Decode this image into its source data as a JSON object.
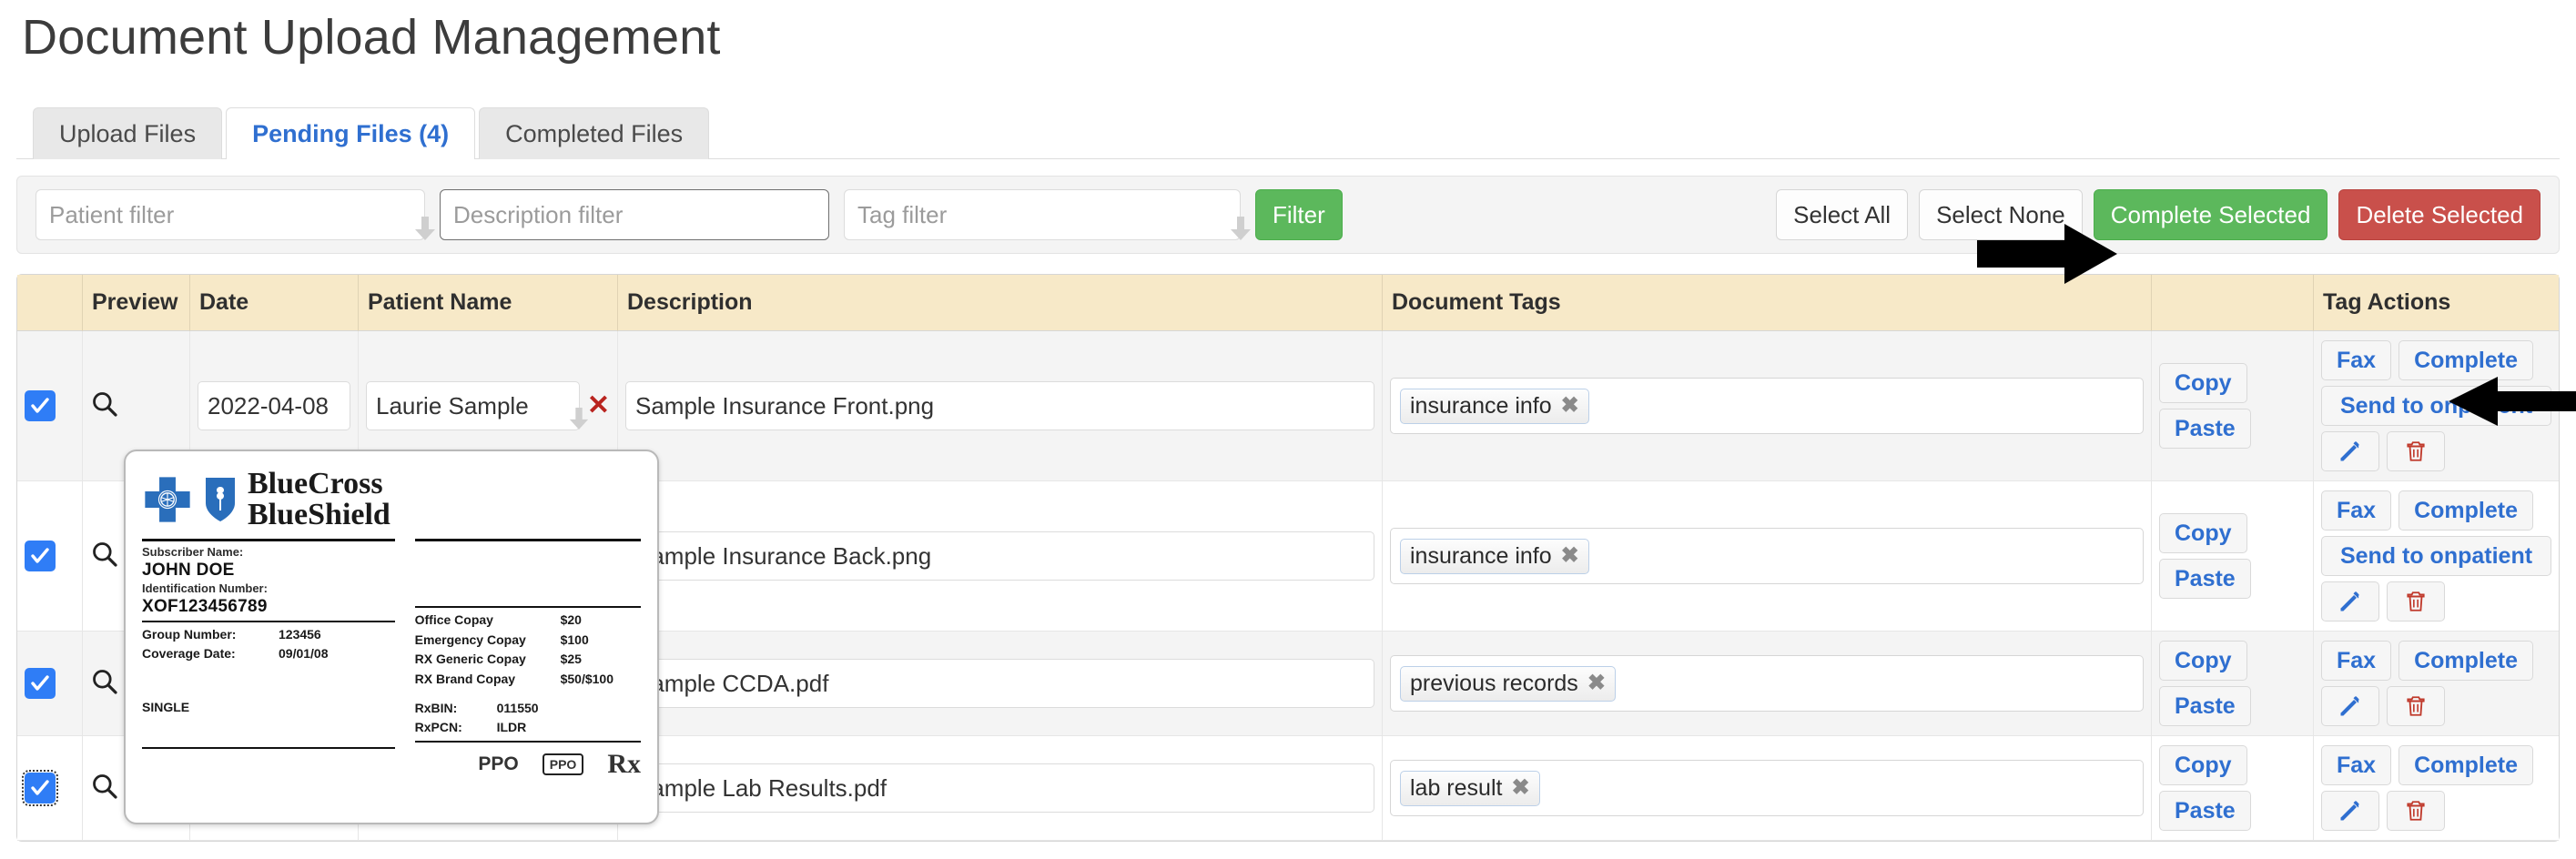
{
  "page": {
    "title": "Document Upload Management"
  },
  "tabs": [
    {
      "label": "Upload Files",
      "active": false
    },
    {
      "label": "Pending Files (4)",
      "active": true
    },
    {
      "label": "Completed Files",
      "active": false
    }
  ],
  "filters": {
    "patient_placeholder": "Patient filter",
    "description_placeholder": "Description filter",
    "tag_placeholder": "Tag filter",
    "filter_button": "Filter"
  },
  "bulk_actions": {
    "select_all": "Select All",
    "select_none": "Select None",
    "complete_selected": "Complete Selected",
    "delete_selected": "Delete Selected"
  },
  "colors": {
    "green": "#5cb85c",
    "red": "#c9504b",
    "link_blue": "#2f6fd0",
    "header_beige": "#f7e9c8",
    "checkbox_blue": "#2f7df6",
    "trash_red": "#c0392b"
  },
  "table": {
    "columns": [
      "",
      "Preview",
      "Date",
      "Patient Name",
      "Description",
      "Document Tags",
      "",
      "Tag Actions"
    ],
    "rows": [
      {
        "checked": true,
        "focused": false,
        "preview_icon": "search-icon",
        "date": "2022-04-08",
        "patient_name": "Laurie Sample",
        "description": "Sample Insurance Front.png",
        "tags": [
          "insurance info"
        ],
        "copy": "Copy",
        "paste": "Paste",
        "fax": "Fax",
        "complete": "Complete",
        "send_to_onpatient": "Send to onpatient",
        "has_send": true
      },
      {
        "checked": true,
        "focused": false,
        "preview_icon": "search-icon",
        "date": "",
        "patient_name": "",
        "description": "Sample Insurance Back.png",
        "tags": [
          "insurance info"
        ],
        "copy": "Copy",
        "paste": "Paste",
        "fax": "Fax",
        "complete": "Complete",
        "send_to_onpatient": "Send to onpatient",
        "has_send": true
      },
      {
        "checked": true,
        "focused": false,
        "preview_icon": "search-icon",
        "date": "",
        "patient_name": "",
        "description": "Sample CCDA.pdf",
        "tags": [
          "previous records"
        ],
        "copy": "Copy",
        "paste": "Paste",
        "fax": "Fax",
        "complete": "Complete",
        "send_to_onpatient": "",
        "has_send": false
      },
      {
        "checked": true,
        "focused": true,
        "preview_icon": "search-icon",
        "date": "",
        "patient_name": "",
        "description": "Sample Lab Results.pdf",
        "tags": [
          "lab result"
        ],
        "copy": "Copy",
        "paste": "Paste",
        "fax": "Fax",
        "complete": "Complete",
        "send_to_onpatient": "",
        "has_send": false
      }
    ]
  },
  "preview_popup": {
    "brand_line1": "BlueCross",
    "brand_line2": "BlueShield",
    "subscriber_label": "Subscriber Name:",
    "subscriber_value": "JOHN DOE",
    "id_label": "Identification Number:",
    "id_value": "XOF123456789",
    "group_label": "Group Number:",
    "group_value": "123456",
    "coverage_label": "Coverage Date:",
    "coverage_value": "09/01/08",
    "plan_type": "SINGLE",
    "copays": [
      {
        "label": "Office Copay",
        "value": "$20"
      },
      {
        "label": "Emergency Copay",
        "value": "$100"
      },
      {
        "label": "RX Generic Copay",
        "value": "$25"
      },
      {
        "label": "RX Brand Copay",
        "value": "$50/$100"
      }
    ],
    "rxbin_label": "RxBIN:",
    "rxbin_value": "011550",
    "rxpcn_label": "RxPCN:",
    "rxpcn_value": "ILDR",
    "ppo_text": "PPO",
    "ppo_badge": "PPO",
    "rx_symbol": "Rx"
  },
  "annotations": {
    "arrow_toolbar": "arrow-pointing-right-to-complete-selected",
    "arrow_row": "arrow-pointing-left-to-complete-button"
  }
}
